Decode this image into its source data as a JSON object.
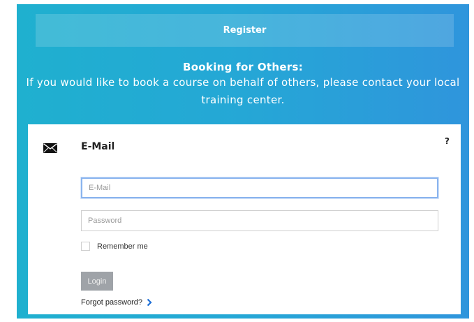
{
  "header": {
    "register_label": "Register"
  },
  "booking": {
    "title": "Booking for Others:",
    "text": "If you would like to book a course on behalf of others, please contact your local training center."
  },
  "login_card": {
    "icon": "envelope-icon",
    "title": "E-Mail",
    "help_label": "?",
    "email_placeholder": "E-Mail",
    "email_value": "",
    "password_placeholder": "Password",
    "password_value": "",
    "remember_label": "Remember me",
    "remember_checked": false,
    "login_label": "Login",
    "forgot_label": "Forgot password?"
  },
  "colors": {
    "panel_gradient_start": "#1fb0cf",
    "panel_gradient_end": "#2f95dc",
    "login_button": "#9fa3a8",
    "link_chevron": "#1f6fd6",
    "focus_border": "#8ab4ee"
  }
}
